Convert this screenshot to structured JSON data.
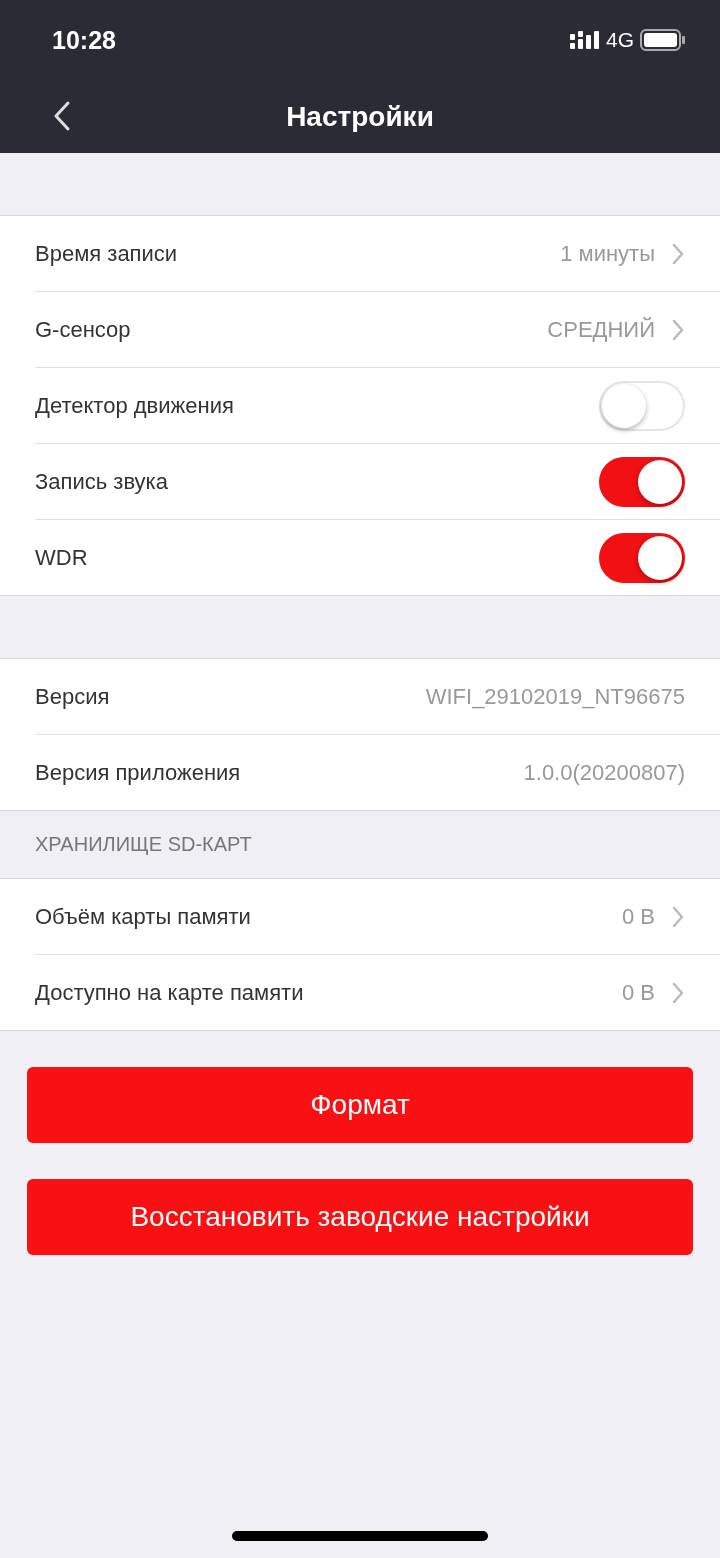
{
  "status_bar": {
    "time": "10:28",
    "network": "4G"
  },
  "nav": {
    "title": "Настройки"
  },
  "groups": [
    {
      "rows": [
        {
          "kind": "value",
          "label": "Время записи",
          "value": "1 минуты",
          "chevron": true
        },
        {
          "kind": "value",
          "label": "G-сенсор",
          "value": "СРЕДНИЙ",
          "chevron": true
        },
        {
          "kind": "toggle",
          "label": "Детектор движения",
          "on": false
        },
        {
          "kind": "toggle",
          "label": "Запись звука",
          "on": true
        },
        {
          "kind": "toggle",
          "label": "WDR",
          "on": true
        }
      ]
    },
    {
      "rows": [
        {
          "kind": "value",
          "label": "Версия",
          "value": "WIFI_29102019_NT96675",
          "chevron": false
        },
        {
          "kind": "value",
          "label": "Версия приложения",
          "value": "1.0.0(20200807)",
          "chevron": false
        }
      ]
    },
    {
      "header": "ХРАНИЛИЩЕ SD-КАРТ",
      "rows": [
        {
          "kind": "value",
          "label": "Объём карты памяти",
          "value": "0 B",
          "chevron": true
        },
        {
          "kind": "value",
          "label": "Доступно на карте памяти",
          "value": "0 B",
          "chevron": true
        }
      ]
    }
  ],
  "buttons": [
    "Формат",
    "Восстановить заводские настройки"
  ]
}
